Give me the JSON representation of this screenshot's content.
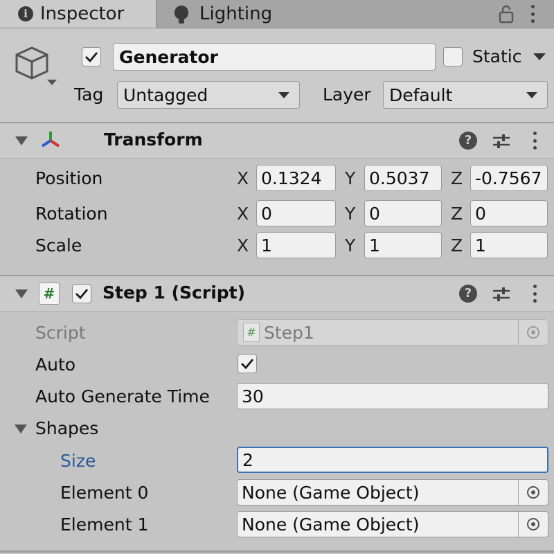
{
  "tabs": [
    {
      "label": "Inspector",
      "icon": "info-icon"
    },
    {
      "label": "Lighting",
      "icon": "lightbulb-icon"
    }
  ],
  "header": {
    "object_name": "Generator",
    "active": true,
    "static_label": "Static",
    "static_checked": false,
    "tag_label": "Tag",
    "tag_value": "Untagged",
    "layer_label": "Layer",
    "layer_value": "Default"
  },
  "transform": {
    "title": "Transform",
    "rows": [
      {
        "label": "Position",
        "x": "0.1324",
        "y": "0.5037",
        "z": "-0.7567"
      },
      {
        "label": "Rotation",
        "x": "0",
        "y": "0",
        "z": "0"
      },
      {
        "label": "Scale",
        "x": "1",
        "y": "1",
        "z": "1"
      }
    ],
    "axes": {
      "x": "X",
      "y": "Y",
      "z": "Z"
    }
  },
  "script_component": {
    "title": "Step 1 (Script)",
    "enabled": true,
    "script_label": "Script",
    "script_value": "Step1",
    "auto_label": "Auto",
    "auto_checked": true,
    "auto_generate_label": "Auto Generate Time",
    "auto_generate_value": "30",
    "shapes_label": "Shapes",
    "size_label": "Size",
    "size_value": "2",
    "elements": [
      {
        "label": "Element 0",
        "value": "None (Game Object)"
      },
      {
        "label": "Element 1",
        "value": "None (Game Object)"
      }
    ]
  },
  "colors": {
    "accent_blue": "#3a72b0",
    "size_label_blue": "#2a5a9a",
    "script_green": "#2e7d32"
  }
}
